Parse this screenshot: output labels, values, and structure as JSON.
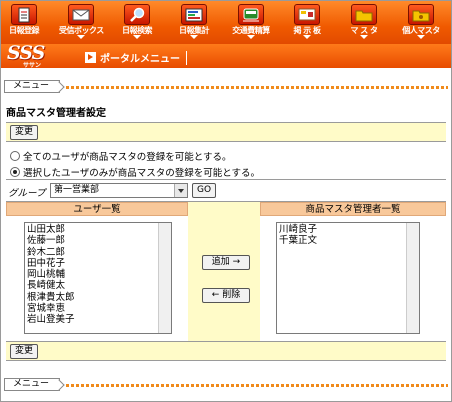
{
  "nav": [
    {
      "label": "日報登録",
      "icon": "document-icon"
    },
    {
      "label": "受信ボックス",
      "icon": "envelope-icon"
    },
    {
      "label": "日報検索",
      "icon": "magnifier-icon"
    },
    {
      "label": "日報集計",
      "icon": "bar-chart-icon"
    },
    {
      "label": "交通費精算",
      "icon": "train-icon"
    },
    {
      "label": "掲 示 板",
      "icon": "bulletin-board-icon"
    },
    {
      "label": "マ ス タ",
      "icon": "folder-icon"
    },
    {
      "label": "個人マスタ",
      "icon": "personal-folder-icon"
    }
  ],
  "logo": {
    "text": "SSS",
    "sub": "ササン"
  },
  "breadcrumb": {
    "portal": "ポータルメニュー"
  },
  "menu_label": "メニュー",
  "page_title": "商品マスタ管理者設定",
  "change_button": "変更",
  "radios": [
    {
      "label": "全てのユーザが商品マスタの登録を可能とする。",
      "selected": false
    },
    {
      "label": "選択したユーザのみが商品マスタの登録を可能とする。",
      "selected": true
    }
  ],
  "group": {
    "label": "グループ",
    "selected": "第一営業部",
    "go": "GO"
  },
  "users": {
    "header": "ユーザ一覧",
    "items": [
      "山田太郎",
      "佐藤一郎",
      "鈴木二郎",
      "田中花子",
      "岡山桃輔",
      "長崎健太",
      "根津貴太郎",
      "宮城幸恵",
      "岩山登美子"
    ]
  },
  "admins": {
    "header": "商品マスタ管理者一覧",
    "items": [
      "川崎良子",
      "千葉正文"
    ]
  },
  "add_button": "追加 →",
  "remove_button": "← 削除",
  "colors": {
    "accent": "#f05a00",
    "panel": "#fffbc8",
    "header": "#f8c89a"
  }
}
